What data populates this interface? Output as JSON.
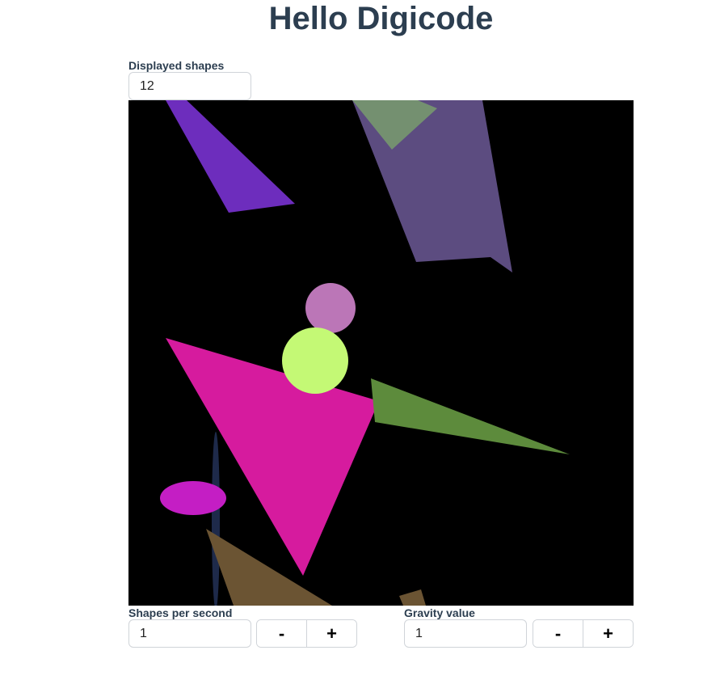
{
  "page": {
    "title": "Hello Digicode"
  },
  "displayed_shapes": {
    "label": "Displayed shapes",
    "value": "12"
  },
  "shapes_per_second": {
    "label": "Shapes per second",
    "value": "1",
    "decrement_label": "-",
    "increment_label": "+"
  },
  "gravity": {
    "label": "Gravity value",
    "value": "1",
    "decrement_label": "-",
    "increment_label": "+"
  },
  "canvas": {
    "background": "#000000",
    "shape_colors": {
      "purple_triangle": "#6d2dbd",
      "slate_quad": "#5c4c80",
      "sage_triangle": "#749070",
      "orchid_circle": "#bb76b7",
      "lime_circle": "#c4f975",
      "magenta_triangle": "#d61b9e",
      "green_triangle": "#5d8b3c",
      "navy_ellipse": "#1e2a4a",
      "violet_ellipse": "#c41ec4",
      "brown_triangle": "#6b5433",
      "brown_quad": "#6b5433"
    }
  }
}
